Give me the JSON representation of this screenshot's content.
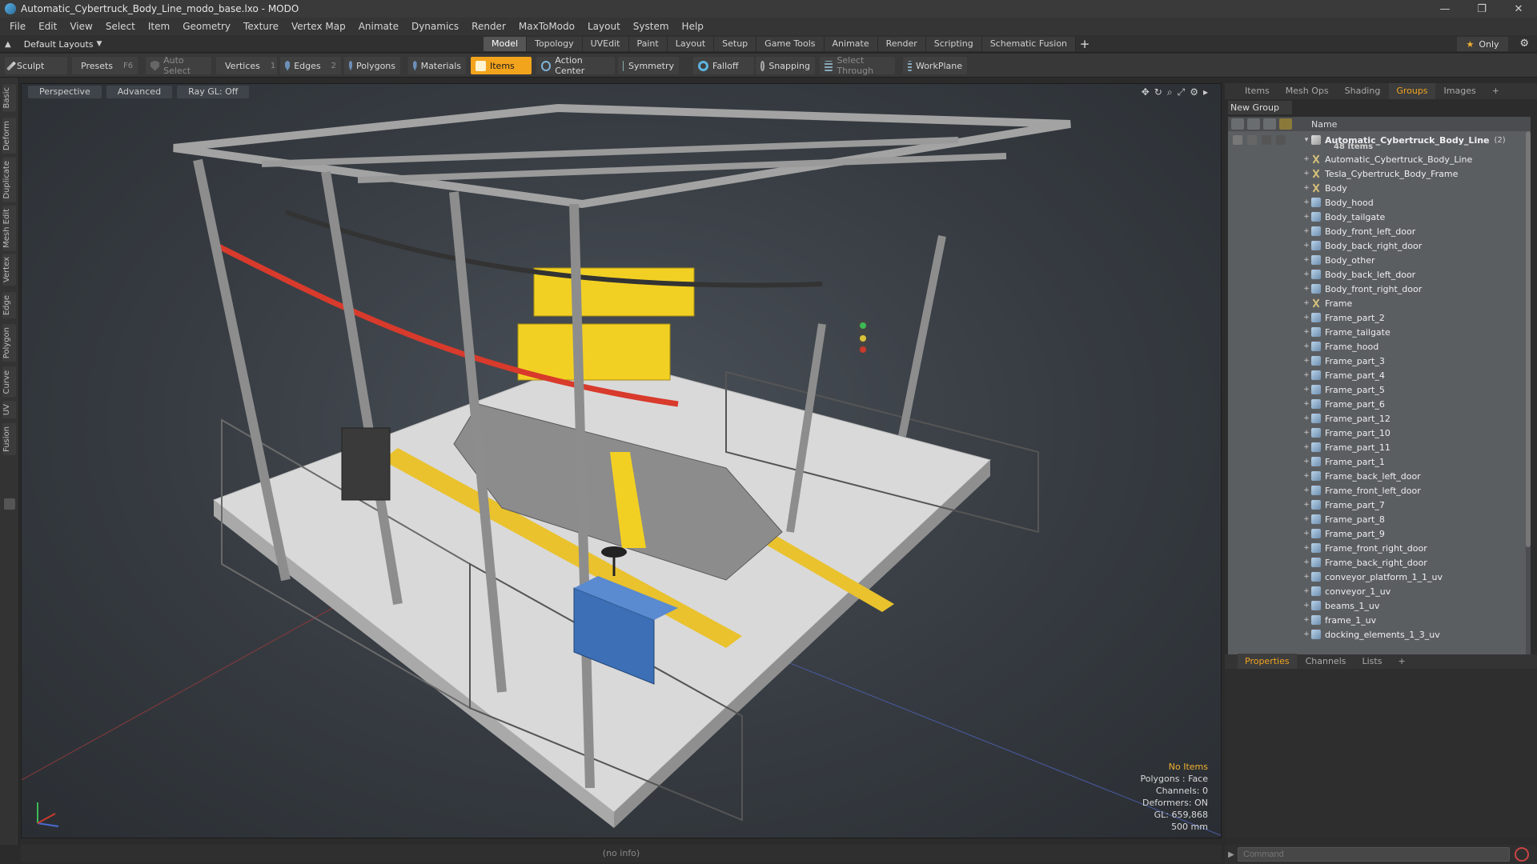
{
  "window": {
    "title": "Automatic_Cybertruck_Body_Line_modo_base.lxo - MODO",
    "controls": [
      "—",
      "❐",
      "✕"
    ]
  },
  "menu": [
    "File",
    "Edit",
    "View",
    "Select",
    "Item",
    "Geometry",
    "Texture",
    "Vertex Map",
    "Animate",
    "Dynamics",
    "Render",
    "MaxToModo",
    "Layout",
    "System",
    "Help"
  ],
  "layout_bar": {
    "layout_name": "Default Layouts",
    "tabs": [
      "Model",
      "Topology",
      "UVEdit",
      "Paint",
      "Layout",
      "Setup",
      "Game Tools",
      "Animate",
      "Render",
      "Scripting",
      "Schematic Fusion"
    ],
    "active_tab": "Model",
    "only_label": "Only"
  },
  "toolbar": {
    "sculpt": "Sculpt",
    "presets": "Presets",
    "presets_key": "F6",
    "auto_select": "Auto Select",
    "vertices": "Vertices",
    "vertices_key": "1",
    "edges": "Edges",
    "edges_key": "2",
    "polygons": "Polygons",
    "materials": "Materials",
    "items": "Items",
    "action_center": "Action Center",
    "symmetry": "Symmetry",
    "falloff": "Falloff",
    "snapping": "Snapping",
    "select_through": "Select Through",
    "workplane": "WorkPlane"
  },
  "left_tabs": [
    "Basic",
    "Deform",
    "Duplicate",
    "Mesh Edit",
    "Vertex",
    "Edge",
    "Polygon",
    "Curve",
    "UV",
    "Fusion"
  ],
  "viewport": {
    "view_mode": "Perspective",
    "shading": "Advanced",
    "raygl": "Ray GL: Off",
    "info": {
      "selection": "No Items",
      "polygons": "Polygons : Face",
      "channels": "Channels: 0",
      "deformers": "Deformers: ON",
      "gl": "GL: 659,868",
      "scale": "500 mm"
    }
  },
  "status": "(no info)",
  "right_panel": {
    "tabs": [
      "Items",
      "Mesh Ops",
      "Shading",
      "Groups",
      "Images"
    ],
    "active_tab": "Groups",
    "new_group": "New Group",
    "name_header": "Name",
    "root": {
      "name": "Automatic_Cybertruck_Body_Line",
      "count": "(2)",
      "items": "48 Items"
    },
    "rows": [
      {
        "name": "Automatic_Cybertruck_Body_Line",
        "type": "locator"
      },
      {
        "name": "Tesla_Cybertruck_Body_Frame",
        "type": "locator"
      },
      {
        "name": "Body",
        "type": "locator"
      },
      {
        "name": "Body_hood",
        "type": "mesh"
      },
      {
        "name": "Body_tailgate",
        "type": "mesh"
      },
      {
        "name": "Body_front_left_door",
        "type": "mesh"
      },
      {
        "name": "Body_back_right_door",
        "type": "mesh"
      },
      {
        "name": "Body_other",
        "type": "mesh"
      },
      {
        "name": "Body_back_left_door",
        "type": "mesh"
      },
      {
        "name": "Body_front_right_door",
        "type": "mesh"
      },
      {
        "name": "Frame",
        "type": "locator"
      },
      {
        "name": "Frame_part_2",
        "type": "mesh"
      },
      {
        "name": "Frame_tailgate",
        "type": "mesh"
      },
      {
        "name": "Frame_hood",
        "type": "mesh"
      },
      {
        "name": "Frame_part_3",
        "type": "mesh"
      },
      {
        "name": "Frame_part_4",
        "type": "mesh"
      },
      {
        "name": "Frame_part_5",
        "type": "mesh"
      },
      {
        "name": "Frame_part_6",
        "type": "mesh"
      },
      {
        "name": "Frame_part_12",
        "type": "mesh"
      },
      {
        "name": "Frame_part_10",
        "type": "mesh"
      },
      {
        "name": "Frame_part_11",
        "type": "mesh"
      },
      {
        "name": "Frame_part_1",
        "type": "mesh"
      },
      {
        "name": "Frame_back_left_door",
        "type": "mesh"
      },
      {
        "name": "Frame_front_left_door",
        "type": "mesh"
      },
      {
        "name": "Frame_part_7",
        "type": "mesh"
      },
      {
        "name": "Frame_part_8",
        "type": "mesh"
      },
      {
        "name": "Frame_part_9",
        "type": "mesh"
      },
      {
        "name": "Frame_front_right_door",
        "type": "mesh"
      },
      {
        "name": "Frame_back_right_door",
        "type": "mesh"
      },
      {
        "name": "conveyor_platform_1_1_uv",
        "type": "mesh"
      },
      {
        "name": "conveyor_1_uv",
        "type": "mesh"
      },
      {
        "name": "beams_1_uv",
        "type": "mesh"
      },
      {
        "name": "frame_1_uv",
        "type": "mesh"
      },
      {
        "name": "docking_elements_1_3_uv",
        "type": "mesh"
      }
    ],
    "props_tabs": [
      "Properties",
      "Channels",
      "Lists"
    ],
    "props_active": "Properties",
    "command_placeholder": "Command"
  },
  "colors": {
    "accent": "#f3a41d",
    "frame": "#9a9a9a",
    "robot": "#f2d023",
    "cable_red": "#d83a2c",
    "cabinet": "#3c6fb5"
  }
}
